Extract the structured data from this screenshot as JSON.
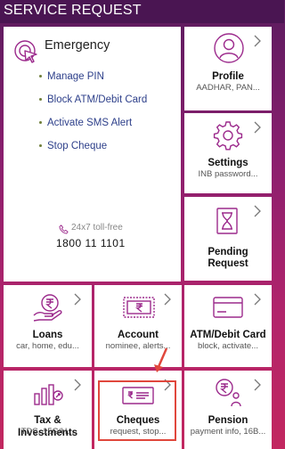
{
  "header": {
    "title": "SERVICE REQUEST"
  },
  "emergency": {
    "title": "Emergency",
    "items": [
      "Manage PIN",
      "Block ATM/Debit Card",
      "Activate SMS Alert",
      "Stop Cheque"
    ],
    "tollfree_label": "24x7 toll-free",
    "tollfree_number": "1800 11 1101"
  },
  "tiles": {
    "profile": {
      "label": "Profile",
      "sub": "AADHAR, PAN..."
    },
    "settings": {
      "label": "Settings",
      "sub": "INB password..."
    },
    "pending": {
      "label": "Pending Request",
      "label1": "Pending",
      "label2": "Request"
    },
    "loans": {
      "label": "Loans",
      "sub": "car, home, edu..."
    },
    "account": {
      "label": "Account",
      "sub": "nominee, alerts..."
    },
    "atm": {
      "label": "ATM/Debit Card",
      "sub": "block, activate..."
    },
    "tax": {
      "label": "Tax & Investments",
      "sub": "TDS, 15G/H..."
    },
    "cheques": {
      "label": "Cheques",
      "sub": "request, stop..."
    },
    "pension": {
      "label": "Pension",
      "sub": "payment info, 16B..."
    }
  },
  "colors": {
    "accent": "#9c2a8c",
    "header_bg": "#4a1552",
    "link": "#2d3f8a",
    "highlight": "#e0473c"
  },
  "icons": {
    "emergency": "cursor-click-icon",
    "profile": "user-icon",
    "settings": "gear-icon",
    "pending": "hourglass-document-icon",
    "loans": "rupee-hand-icon",
    "account": "rupee-note-icon",
    "atm": "card-icon",
    "tax": "bar-chart-icon",
    "cheques": "cheque-icon",
    "pension": "rupee-person-icon"
  }
}
